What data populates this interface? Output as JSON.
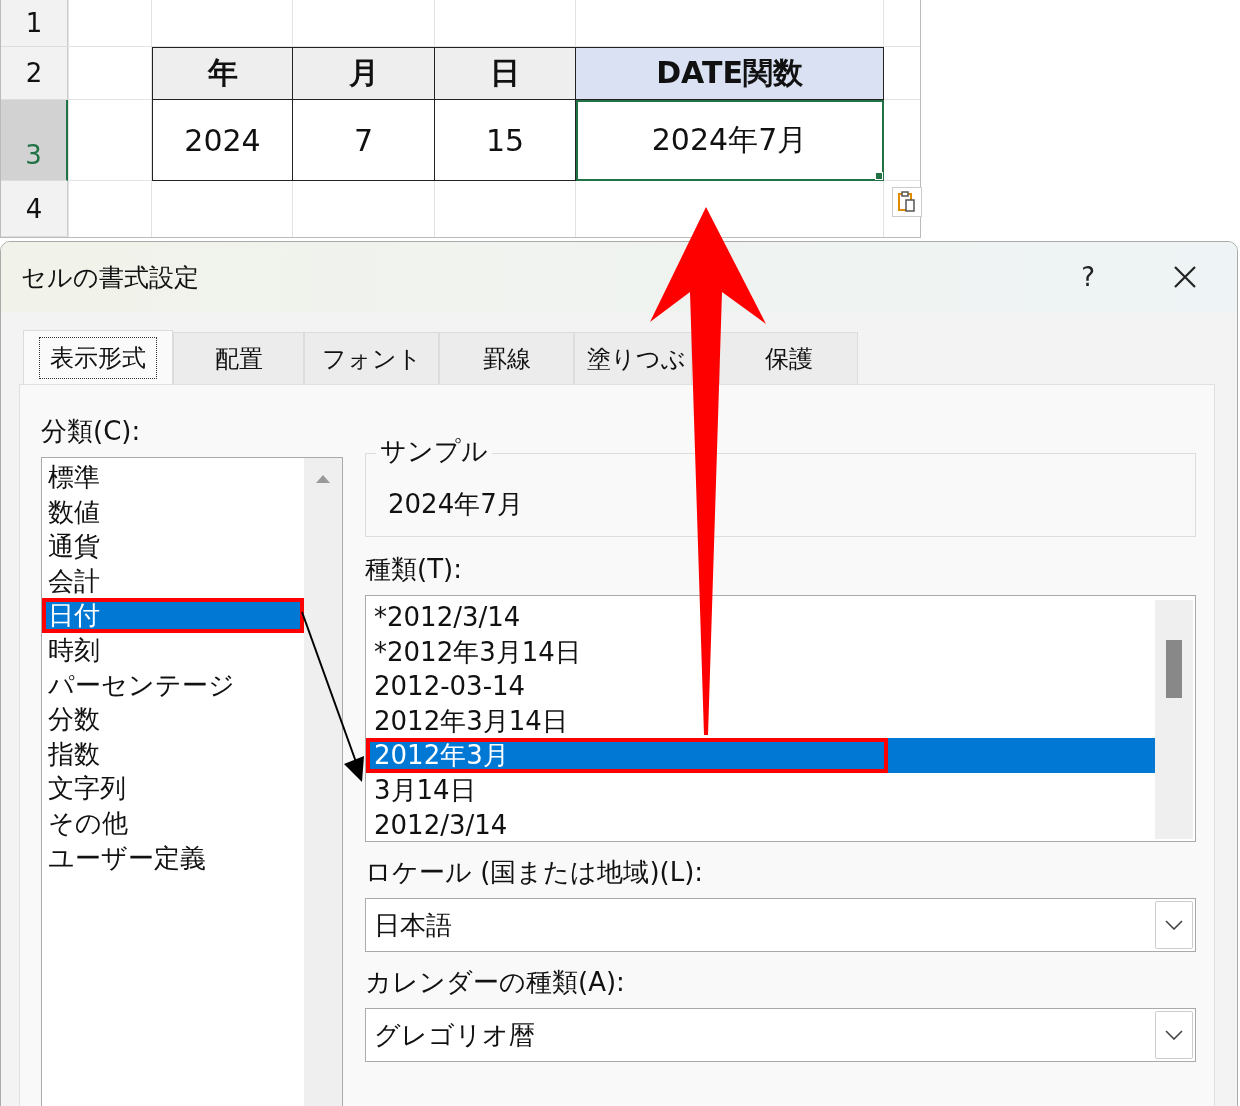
{
  "spreadsheet": {
    "row_headers": [
      {
        "label": "1",
        "selected": false
      },
      {
        "label": "2",
        "selected": false
      },
      {
        "label": "3",
        "selected": true
      },
      {
        "label": "4",
        "selected": false
      }
    ],
    "header_cells": [
      {
        "text": "年",
        "highlighted": false
      },
      {
        "text": "月",
        "highlighted": false
      },
      {
        "text": "日",
        "highlighted": false
      },
      {
        "text": "DATE関数",
        "highlighted": true
      }
    ],
    "data_cells": [
      {
        "text": "2024",
        "selected": false
      },
      {
        "text": "7",
        "selected": false
      },
      {
        "text": "15",
        "selected": false
      },
      {
        "text": "2024年7月",
        "selected": true
      }
    ]
  },
  "dialog": {
    "title": "セルの書式設定",
    "help": "?",
    "tabs": [
      {
        "label": "表示形式",
        "selected": true
      },
      {
        "label": "配置",
        "selected": false
      },
      {
        "label": "フォント",
        "selected": false
      },
      {
        "label": "罫線",
        "selected": false
      },
      {
        "label": "塗りつぶ",
        "selected": false
      },
      {
        "label": "保護",
        "selected": false
      }
    ],
    "category_label": "分類(C):",
    "categories": [
      {
        "label": "標準",
        "selected": false,
        "highlighted": false
      },
      {
        "label": "数値",
        "selected": false,
        "highlighted": false
      },
      {
        "label": "通貨",
        "selected": false,
        "highlighted": false
      },
      {
        "label": "会計",
        "selected": false,
        "highlighted": false
      },
      {
        "label": "日付",
        "selected": true,
        "highlighted": true
      },
      {
        "label": "時刻",
        "selected": false,
        "highlighted": false
      },
      {
        "label": "パーセンテージ",
        "selected": false,
        "highlighted": false
      },
      {
        "label": "分数",
        "selected": false,
        "highlighted": false
      },
      {
        "label": "指数",
        "selected": false,
        "highlighted": false
      },
      {
        "label": "文字列",
        "selected": false,
        "highlighted": false
      },
      {
        "label": "その他",
        "selected": false,
        "highlighted": false
      },
      {
        "label": "ユーザー定義",
        "selected": false,
        "highlighted": false
      }
    ],
    "sample": {
      "legend": "サンプル",
      "value": "2024年7月"
    },
    "type_label": "種類(T):",
    "types": [
      {
        "label": "*2012/3/14",
        "selected": false,
        "highlighted": false
      },
      {
        "label": "*2012年3月14日",
        "selected": false,
        "highlighted": false
      },
      {
        "label": "2012-03-14",
        "selected": false,
        "highlighted": false
      },
      {
        "label": "2012年3月14日",
        "selected": false,
        "highlighted": false
      },
      {
        "label": "2012年3月",
        "selected": true,
        "highlighted": true
      },
      {
        "label": "3月14日",
        "selected": false,
        "highlighted": false
      },
      {
        "label": "2012/3/14",
        "selected": false,
        "highlighted": false
      }
    ],
    "locale": {
      "label": "ロケール (国または地域)(L):",
      "value": "日本語"
    },
    "calendar": {
      "label": "カレンダーの種類(A):",
      "value": "グレゴリオ暦"
    }
  }
}
